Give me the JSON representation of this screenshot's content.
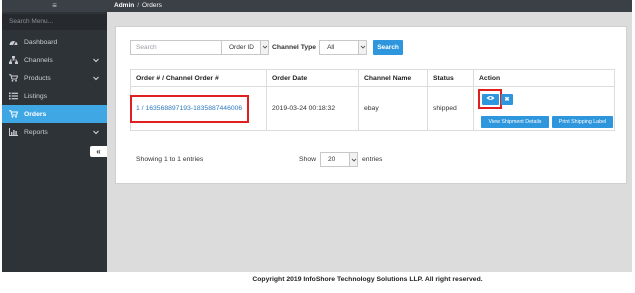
{
  "sidebar": {
    "search_placeholder": "Search Menu...",
    "items": [
      {
        "label": "Dashboard",
        "icon": "dashboard-icon",
        "active": false,
        "has_children": false
      },
      {
        "label": "Channels",
        "icon": "sitemap-icon",
        "active": false,
        "has_children": true
      },
      {
        "label": "Products",
        "icon": "cart-icon",
        "active": false,
        "has_children": true
      },
      {
        "label": "Listings",
        "icon": "list-icon",
        "active": false,
        "has_children": false
      },
      {
        "label": "Orders",
        "icon": "cart-icon",
        "active": true,
        "has_children": false
      },
      {
        "label": "Reports",
        "icon": "bar-chart-icon",
        "active": false,
        "has_children": true
      }
    ],
    "collapse_label": "«"
  },
  "breadcrumb": {
    "root": "Admin",
    "separator": "/",
    "current": "Orders"
  },
  "filters": {
    "search_placeholder": "Search",
    "field_select": "Order ID",
    "channel_type_label": "Channel Type",
    "channel_type_value": "All",
    "search_button": "Search"
  },
  "table": {
    "headers": [
      "Order # / Channel Order #",
      "Order Date",
      "Channel Name",
      "Status",
      "Action"
    ],
    "rows": [
      {
        "order": "1 / 163568897193-1835887446006",
        "date": "2019-03-24 00:18:32",
        "channel": "ebay",
        "status": "shipped",
        "actions": {
          "view_icon": "eye-icon",
          "delete_icon": "close-icon",
          "view_shipment": "View Shipment Details",
          "print_label": "Print Shipping Label"
        }
      }
    ]
  },
  "pagination": {
    "showing_text": "Showing 1 to 1 entries",
    "show_label": "Show",
    "page_size": "20",
    "entries_label": "entries"
  },
  "footer": {
    "copyright": "Copyright 2019 InfoShore Technology Solutions LLP. All right reserved."
  },
  "colors": {
    "sidebar_bg": "#2e3338",
    "accent": "#3fa7e3",
    "button": "#2d96dc",
    "highlight": "#e02020",
    "link": "#2d7bbf"
  }
}
